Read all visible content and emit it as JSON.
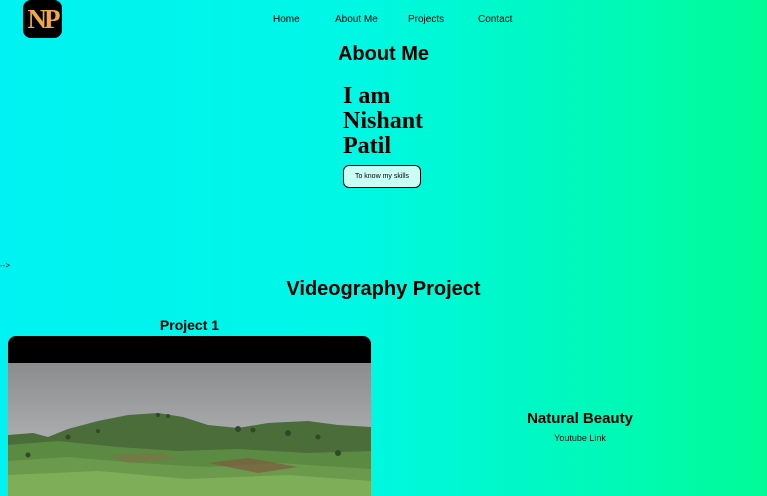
{
  "logo": {
    "text": "NP"
  },
  "nav": {
    "home": "Home",
    "about": "About Me",
    "projects": "Projects",
    "contact": "Contact"
  },
  "about": {
    "title": "About Me",
    "intro": [
      "I am",
      "Nishant",
      "Patil"
    ],
    "button": "To know my skills"
  },
  "stray_text": "-->",
  "videography": {
    "title": "Videography Project",
    "project_label": "Project 1",
    "project_name": "Natural Beauty",
    "project_link": "Youtube Link"
  },
  "colors": {
    "gradient_start": "#00f2f2",
    "gradient_end": "#00fb96",
    "logo_accent": "#f0a940"
  }
}
